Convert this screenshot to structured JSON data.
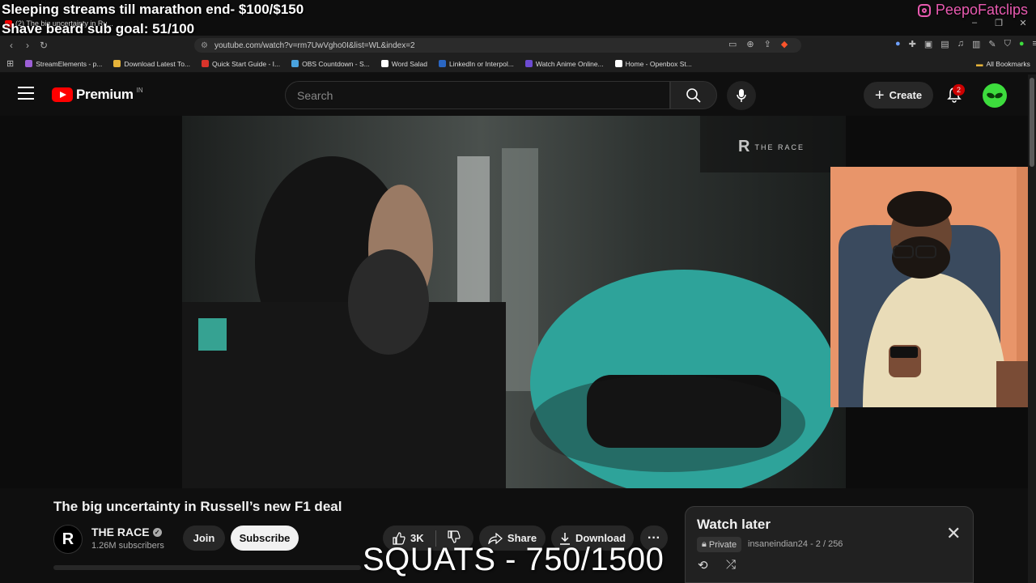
{
  "overlay": {
    "line1": "Sleeping streams till marathon end- $100/$150",
    "line2": "Shave beard sub goal: 51/100",
    "instagram": "PeepoFatclips",
    "squats": "SQUATS - 750/1500"
  },
  "browser": {
    "tab_title": "(2) The big uncertainty in Ru...",
    "url": "youtube.com/watch?v=rm7UwVgho0I&list=WL&index=2",
    "bookmarks": [
      {
        "label": "StreamElements - p...",
        "color": "#9c5fd6"
      },
      {
        "label": "Download Latest To...",
        "color": "#e6b33a"
      },
      {
        "label": "Quick Start Guide - I...",
        "color": "#d9342b"
      },
      {
        "label": "OBS Countdown - S...",
        "color": "#4aa3df"
      },
      {
        "label": "Word Salad",
        "color": "#ffffff"
      },
      {
        "label": "LinkedIn or Interpol...",
        "color": "#2a66c2"
      },
      {
        "label": "Watch Anime Online...",
        "color": "#6c4bd1"
      },
      {
        "label": "Home - Openbox St...",
        "color": "#ffffff"
      }
    ],
    "all_bookmarks": "All Bookmarks"
  },
  "youtube": {
    "logo_text": "Premium",
    "region": "IN",
    "search_placeholder": "Search",
    "create_label": "Create",
    "notification_count": "2"
  },
  "video": {
    "watermark": "THE RACE",
    "title": "The big uncertainty in Russell’s new F1 deal",
    "channel_name": "THE RACE",
    "channel_initial": "R",
    "subscribers": "1.26M subscribers",
    "join_label": "Join",
    "subscribe_label": "Subscribe",
    "likes": "3K",
    "share_label": "Share",
    "download_label": "Download",
    "more_label": "···"
  },
  "watch_later": {
    "title": "Watch later",
    "privacy": "Private",
    "meta": "insaneindian24 - 2 / 256"
  },
  "colors": {
    "brand_red": "#ff0000",
    "background": "#0f0f0f",
    "instagram_pink": "#e85ab0"
  }
}
